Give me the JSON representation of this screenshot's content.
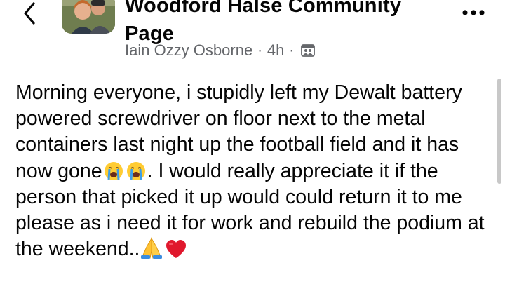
{
  "header": {
    "group_name": "Woodford Halse Community Page",
    "author": "Iain Ozzy Osborne",
    "separator": "·",
    "time_ago": "4h",
    "icons": {
      "back": "chevron-left-icon",
      "more": "more-horizontal-icon",
      "privacy": "group-members-icon"
    }
  },
  "post": {
    "text_part1": "Morning everyone, i stupidly left my Dewalt battery powered screwdriver on floor next to the metal containers last night up the football field and it has now gone",
    "text_part2": ". I would really appreciate it if the person that picked it up would could return it to me please as i need it for work and rebuild the podium at the weekend..",
    "emojis": [
      "loudly-crying-face",
      "loudly-crying-face",
      "folded-hands",
      "red-heart"
    ]
  },
  "colors": {
    "text": "#050505",
    "meta_text": "#65676b",
    "background": "#ffffff",
    "heart": "#e0182d",
    "emoji_yellow": "#ffcc33",
    "tears": "#3c9ee8"
  }
}
